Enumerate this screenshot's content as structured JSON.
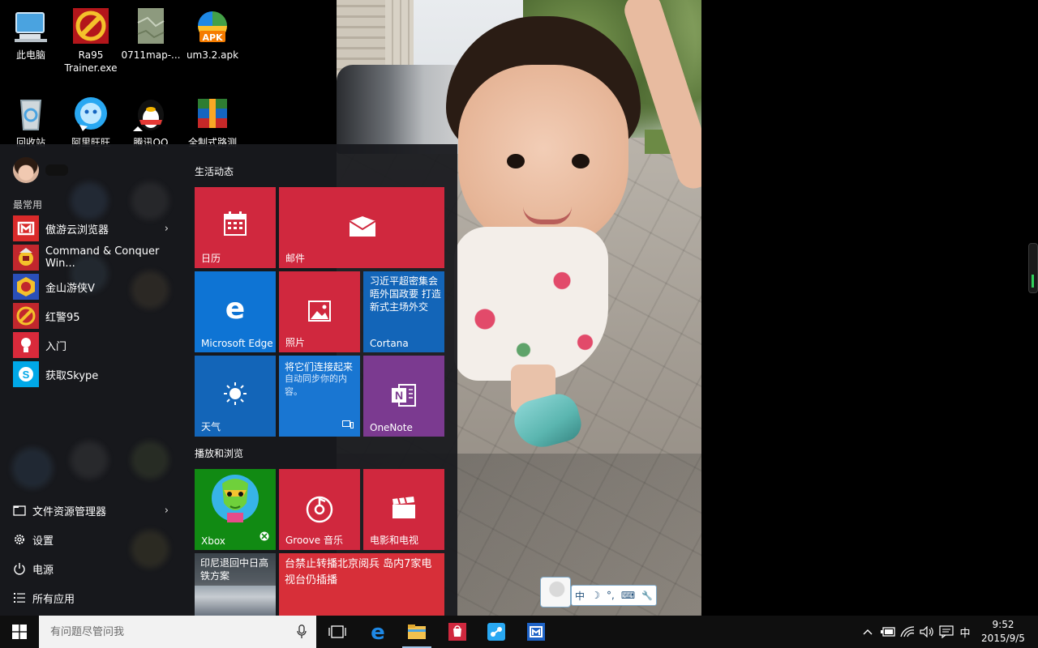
{
  "desktop": {
    "icons": [
      {
        "label": "此电脑"
      },
      {
        "label": "Ra95\nTrainer.exe"
      },
      {
        "label": "0711map-..."
      },
      {
        "label": "um3.2.apk",
        "badge": "APK"
      },
      {
        "label": "回收站"
      },
      {
        "label": "阿里旺旺"
      },
      {
        "label": "腾讯QQ"
      },
      {
        "label": "全制式路测"
      }
    ]
  },
  "start_menu": {
    "most_used_label": "最常用",
    "apps": [
      {
        "label": "傲游云浏览器",
        "icon": "maxthon-icon",
        "color": "#d92a2a"
      },
      {
        "label": "Command & Conquer Win...",
        "icon": "command-conquer-icon",
        "color": "#c1272d"
      },
      {
        "label": "金山游侠V",
        "icon": "jinshan-youxia-icon",
        "color": "#2a4fb8"
      },
      {
        "label": "红警95",
        "icon": "red-alert-icon",
        "color": "#c1272d"
      },
      {
        "label": "入门",
        "icon": "lightbulb-icon",
        "color": "#d92a3b"
      },
      {
        "label": "获取Skype",
        "icon": "skype-icon",
        "color": "#00a8e8"
      }
    ],
    "system": {
      "file_explorer": "文件资源管理器",
      "settings": "设置",
      "power": "电源",
      "all_apps": "所有应用"
    },
    "groups": {
      "life": "生活动态",
      "play": "播放和浏览"
    },
    "tiles": {
      "calendar": "日历",
      "mail": "邮件",
      "edge": "Microsoft Edge",
      "photos": "照片",
      "cortana_news": "习近平超密集会晤外国政要 打造新式主场外交",
      "cortana": "Cortana",
      "weather": "天气",
      "phone_title": "将它们连接起来",
      "phone_body": "自动同步你的内容。",
      "onenote": "OneNote",
      "xbox": "Xbox",
      "groove": "Groove 音乐",
      "movies": "电影和电视",
      "news1": "印尼退回中日高铁方案",
      "news2": "台禁止转播北京阅兵 岛内7家电视台仍插播"
    }
  },
  "ime": {
    "mode": "中",
    "moon": "☽",
    "punct": "°,",
    "keyboard": "⌨",
    "tool": "🔧"
  },
  "taskbar": {
    "search_placeholder": "有问题尽管问我",
    "tray_lang": "中",
    "time": "9:52",
    "date": "2015/9/5"
  },
  "colors": {
    "accent_red": "#d0283e",
    "tile_blue": "#0e74d4",
    "tile_purple": "#7b3a90",
    "tile_green": "#118a13"
  }
}
